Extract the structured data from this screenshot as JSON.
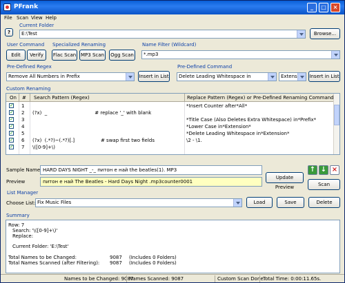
{
  "window": {
    "title": "PFrank"
  },
  "menu": [
    "File",
    "Scan",
    "View",
    "Help"
  ],
  "current_folder": {
    "label": "Current Folder",
    "value": "E:\\Test",
    "browse_label": "Browse..."
  },
  "help_button": "?",
  "user_command": {
    "label": "User Command",
    "edit": "Edit",
    "verify": "Verify"
  },
  "specialized": {
    "label": "Specialized Renaming",
    "flac": "Flac Scan",
    "mp3": "MP3 Scan",
    "ogg": "Ogg Scan"
  },
  "name_filter": {
    "label": "Name Filter (Wildcard)",
    "value": "*.mp3"
  },
  "predefined_regex": {
    "label": "Pre-Defined Regex",
    "value": "Remove All Numbers in Prefix",
    "insert": "Insert in List"
  },
  "predefined_command": {
    "label": "Pre-Defined Command",
    "value": "Delete Leading Whitespace in",
    "scope": "Extensi",
    "insert": "Insert in List"
  },
  "custom_renaming": {
    "label": "Custom Renaming",
    "columns": {
      "on": "On",
      "num": "#",
      "search": "Search Pattern (Regex)",
      "replace": "Replace Pattern (Regex)  or  Pre-Defined Renaming Command"
    },
    "rows": [
      {
        "num": "1",
        "search": "",
        "replace": "*Insert Counter after*All*"
      },
      {
        "num": "2",
        "search": "(?x)  _                               # replace '_' with blank",
        "replace": ""
      },
      {
        "num": "3",
        "search": "",
        "replace": "*Title Case (Also Deletes Extra Whitespace) in*Prefix*"
      },
      {
        "num": "4",
        "search": "",
        "replace": "*Lower Case in*Extension*"
      },
      {
        "num": "5",
        "search": "",
        "replace": "*Delete Leading Whitespace in*Extension*"
      },
      {
        "num": "6",
        "search": "(?x)  (.*?)~(.*?)[.]                 # swap first two fields",
        "replace": "\\2 - \\1."
      },
      {
        "num": "7",
        "search": "\\([0-9]+\\)",
        "replace": ""
      }
    ]
  },
  "sample": {
    "name_label": "Sample Name",
    "name_value": "HARD DAYS NIGHT _-_ питон е най                 the beatles(1).  MP3",
    "preview_label": "Preview",
    "preview_value": "питон е най The Beatles - Hard Days Night .mp3counter0001",
    "update_preview": "Update Preview",
    "scan": "Scan"
  },
  "list_manager": {
    "label": "List Manager",
    "choose_label": "Choose List:",
    "value": "Fix Music Files",
    "load": "Load",
    "save": "Save",
    "delete": "Delete"
  },
  "summary": {
    "label": "Summary",
    "row_line": "Row: 7",
    "search_line": "Search:  '\\([0-9]+\\)'",
    "replace_line": "Replace:",
    "folder_line": "Current Folder:   'E:\\Test'",
    "changed_label": "Total Names to be Changed:",
    "changed_value": "9087",
    "changed_note": "(Includes 0 Folders)",
    "scanned_label": "Total Names Scanned (after Filtering):",
    "scanned_value": "9087",
    "scanned_note": "(Includes 0 Folders)"
  },
  "status": {
    "changed": "Names to be Changed: 9087",
    "scanned": "Names Scanned: 9087",
    "scan_done": "Custom Scan Done.",
    "total_time": "Total Time: 0:00:11.65s."
  },
  "colors": {
    "title_bar": "#0a5fd8",
    "section_label": "#0a3ea8",
    "preview_bg": "#ffffc0"
  }
}
